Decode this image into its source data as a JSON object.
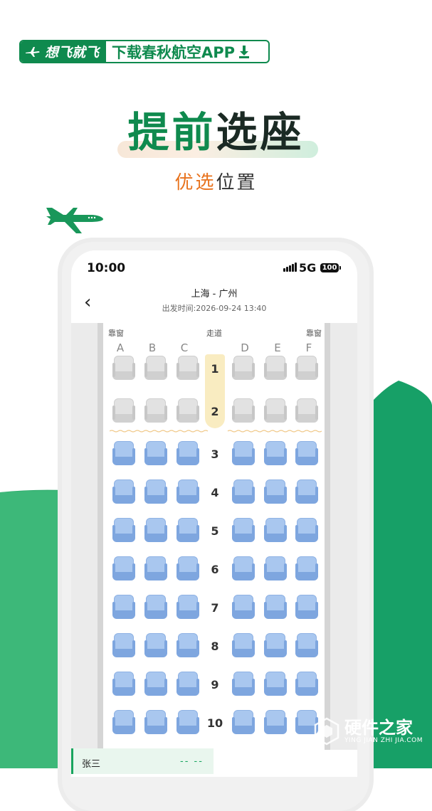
{
  "banner": {
    "brand": "想飞就飞",
    "promo": "下载春秋航空APP"
  },
  "heading": {
    "title_part1": "提前",
    "title_part2": "选座",
    "subtitle_part1": "优选",
    "subtitle_part2": "位置"
  },
  "status_bar": {
    "time": "10:00",
    "network": "5G",
    "battery": "100"
  },
  "flight": {
    "route": "上海 - 广州",
    "departure": "出发时间:2026-09-24 13:40"
  },
  "cabin": {
    "window_label_left": "靠窗",
    "aisle_label": "走道",
    "window_label_right": "靠窗",
    "columns_left": [
      "A",
      "B",
      "C"
    ],
    "columns_right": [
      "D",
      "E",
      "F"
    ],
    "rows": [
      "1",
      "2",
      "3",
      "4",
      "5",
      "6",
      "7",
      "8",
      "9",
      "10"
    ],
    "unavailable_rows": [
      "1",
      "2"
    ],
    "available_rows": [
      "3",
      "4",
      "5",
      "6",
      "7",
      "8",
      "9",
      "10"
    ]
  },
  "passenger": {
    "name": "张三",
    "seat": "-- --"
  },
  "watermark": {
    "main": "硬件之家",
    "sub": "YING JIAN ZHI JIA.COM"
  },
  "colors": {
    "brand_green": "#0f8a4e",
    "accent_orange": "#e8731e",
    "seat_available": "#a9c7ef",
    "seat_unavailable": "#e2e2e2"
  }
}
